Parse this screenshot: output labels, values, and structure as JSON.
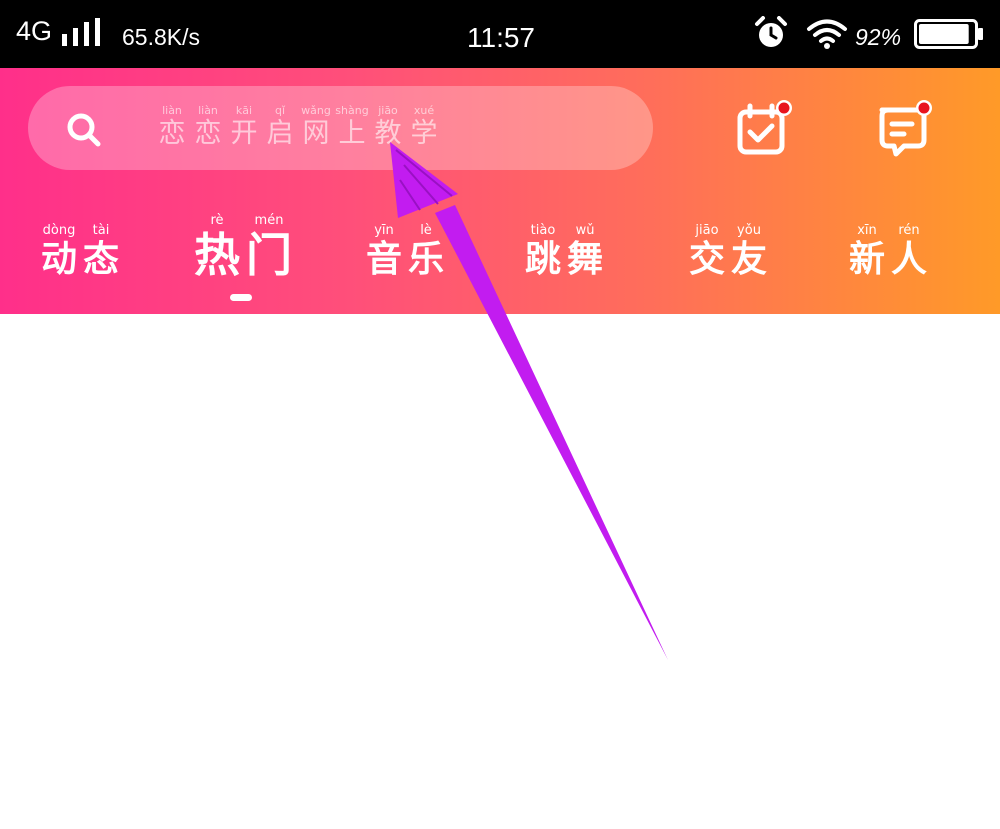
{
  "status_bar": {
    "network": "4G",
    "speed": "65.8K/s",
    "time": "11:57",
    "battery_percent": "92%",
    "icons": [
      "signal-icon",
      "alarm-icon",
      "wifi-icon",
      "battery-icon"
    ],
    "battery_level": 0.92
  },
  "search": {
    "icon": "search-icon",
    "placeholder": [
      {
        "py": "liàn",
        "hz": "恋"
      },
      {
        "py": "liàn",
        "hz": "恋"
      },
      {
        "py": "kāi",
        "hz": "开"
      },
      {
        "py": "qǐ",
        "hz": "启"
      },
      {
        "py": "wǎng",
        "hz": "网"
      },
      {
        "py": "shàng",
        "hz": "上"
      },
      {
        "py": "jiāo",
        "hz": "教"
      },
      {
        "py": "xué",
        "hz": "学"
      }
    ]
  },
  "header_icons": {
    "checkin": "checkin-calendar-icon",
    "message": "message-icon",
    "badge_color": "#e8141e"
  },
  "tabs": [
    {
      "chars": [
        {
          "py": "dòng",
          "hz": "动"
        },
        {
          "py": "tài",
          "hz": "态"
        }
      ],
      "active": false
    },
    {
      "chars": [
        {
          "py": "rè",
          "hz": "热"
        },
        {
          "py": "mén",
          "hz": "门"
        }
      ],
      "active": true
    },
    {
      "chars": [
        {
          "py": "yīn",
          "hz": "音"
        },
        {
          "py": "lè",
          "hz": "乐"
        }
      ],
      "active": false
    },
    {
      "chars": [
        {
          "py": "tiào",
          "hz": "跳"
        },
        {
          "py": "wǔ",
          "hz": "舞"
        }
      ],
      "active": false
    },
    {
      "chars": [
        {
          "py": "jiāo",
          "hz": "交"
        },
        {
          "py": "yǒu",
          "hz": "友"
        }
      ],
      "active": false
    },
    {
      "chars": [
        {
          "py": "xīn",
          "hz": "新"
        },
        {
          "py": "rén",
          "hz": "人"
        }
      ],
      "active": false
    }
  ],
  "colors": {
    "gradient_start": "#ff2f8a",
    "gradient_end": "#ff9a28",
    "annotation_arrow": "#c21cf0"
  },
  "annotation": {
    "icon": "arrow-annotation"
  }
}
